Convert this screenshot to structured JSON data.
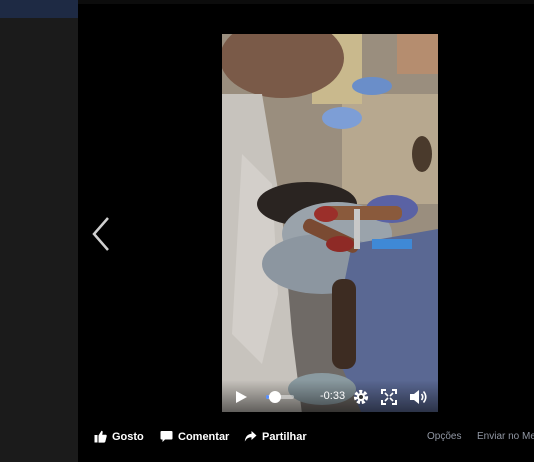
{
  "player": {
    "time_remaining": "-0:33",
    "progress_fraction": 0.1,
    "icons": [
      "play-icon",
      "gear-icon",
      "fullscreen-icon",
      "volume-icon"
    ]
  },
  "actions": {
    "like_label": "Gosto",
    "comment_label": "Comentar",
    "share_label": "Partilhar",
    "options_label": "Opções",
    "send_label": "Enviar no Mes"
  },
  "colors": {
    "theater_bg": "#000000",
    "progress_accent": "#5890ff",
    "muted_text": "#9197a3"
  }
}
